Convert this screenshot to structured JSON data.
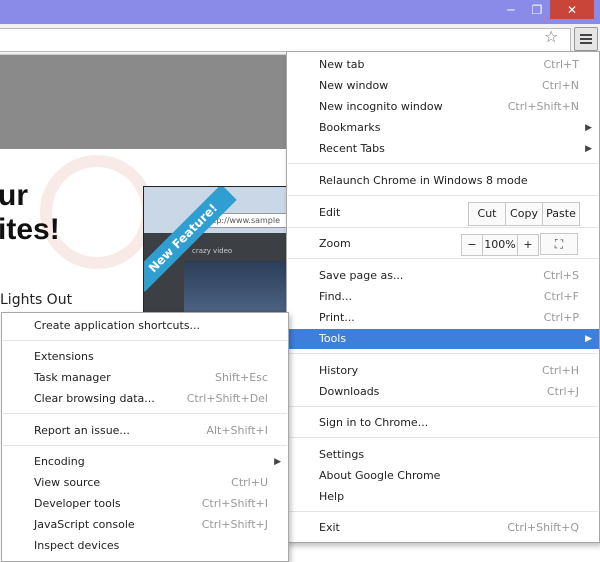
{
  "window": {
    "minimize_icon": "minimize-icon",
    "restore_icon": "restore-icon",
    "close_icon": "close-icon",
    "minimize_glyph": "─",
    "restore_glyph": "❐",
    "close_glyph": "✕"
  },
  "toolbar": {
    "star_glyph": "☆",
    "star_icon": "star-icon",
    "menu_icon": "hamburger-menu-icon"
  },
  "page": {
    "headline_line1": "ur",
    "headline_line2": "ites!",
    "lights_out": "Lights Out",
    "preview_url": "http://www.sample",
    "preview_video_title": "crazy video",
    "ribbon": "New Feature!"
  },
  "main_menu": {
    "new_tab": {
      "label": "New tab",
      "shortcut": "Ctrl+T"
    },
    "new_window": {
      "label": "New window",
      "shortcut": "Ctrl+N"
    },
    "new_incognito": {
      "label": "New incognito window",
      "shortcut": "Ctrl+Shift+N"
    },
    "bookmarks": {
      "label": "Bookmarks"
    },
    "recent_tabs": {
      "label": "Recent Tabs"
    },
    "relaunch": {
      "label": "Relaunch Chrome in Windows 8 mode"
    },
    "edit": {
      "label": "Edit",
      "cut": "Cut",
      "copy": "Copy",
      "paste": "Paste"
    },
    "zoom": {
      "label": "Zoom",
      "minus": "−",
      "value": "100%",
      "plus": "+",
      "fullscreen_glyph": "⛶"
    },
    "save_page": {
      "label": "Save page as...",
      "shortcut": "Ctrl+S"
    },
    "find": {
      "label": "Find...",
      "shortcut": "Ctrl+F"
    },
    "print": {
      "label": "Print...",
      "shortcut": "Ctrl+P"
    },
    "tools": {
      "label": "Tools"
    },
    "history": {
      "label": "History",
      "shortcut": "Ctrl+H"
    },
    "downloads": {
      "label": "Downloads",
      "shortcut": "Ctrl+J"
    },
    "sign_in": {
      "label": "Sign in to Chrome..."
    },
    "settings": {
      "label": "Settings"
    },
    "about": {
      "label": "About Google Chrome"
    },
    "help": {
      "label": "Help"
    },
    "exit": {
      "label": "Exit",
      "shortcut": "Ctrl+Shift+Q"
    },
    "submenu_arrow": "▶"
  },
  "tools_menu": {
    "create_shortcuts": {
      "label": "Create application shortcuts..."
    },
    "extensions": {
      "label": "Extensions"
    },
    "task_manager": {
      "label": "Task manager",
      "shortcut": "Shift+Esc"
    },
    "clear_browsing": {
      "label": "Clear browsing data...",
      "shortcut": "Ctrl+Shift+Del"
    },
    "report_issue": {
      "label": "Report an issue...",
      "shortcut": "Alt+Shift+I"
    },
    "encoding": {
      "label": "Encoding"
    },
    "view_source": {
      "label": "View source",
      "shortcut": "Ctrl+U"
    },
    "developer_tools": {
      "label": "Developer tools",
      "shortcut": "Ctrl+Shift+I"
    },
    "javascript_console": {
      "label": "JavaScript console",
      "shortcut": "Ctrl+Shift+J"
    },
    "inspect_devices": {
      "label": "Inspect devices"
    }
  },
  "colors": {
    "titlebar": "#8a8ae8",
    "highlight": "#3e7fdc",
    "close": "#c9453a",
    "ribbon": "#2f9ed0"
  }
}
